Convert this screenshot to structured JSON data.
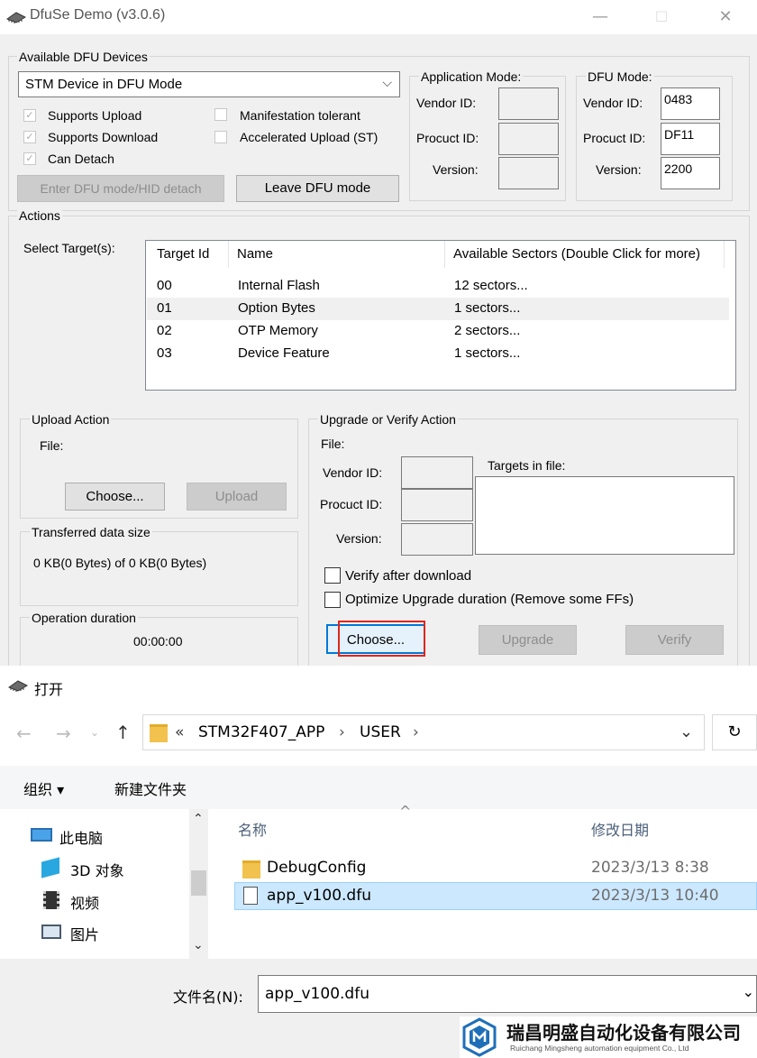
{
  "main_window": {
    "title": "DfuSe Demo (v3.0.6)",
    "controls": {
      "minimize": "—",
      "maximize": "☐",
      "close": "✕"
    },
    "devices": {
      "label": "Available DFU Devices",
      "selected": "STM Device in DFU Mode",
      "checks": [
        {
          "label": "Supports Upload",
          "checked": true
        },
        {
          "label": "Supports Download",
          "checked": true
        },
        {
          "label": "Can Detach",
          "checked": true
        },
        {
          "label": "Manifestation tolerant",
          "checked": false
        },
        {
          "label": "Accelerated Upload (ST)",
          "checked": false
        }
      ],
      "enter_dfu_button": "Enter DFU mode/HID detach",
      "leave_dfu_button": "Leave DFU mode"
    },
    "app_mode": {
      "label": "Application Mode:",
      "vendor_label": "Vendor ID:",
      "product_label": "Procuct ID:",
      "version_label": "Version:",
      "vendor": "",
      "product": "",
      "version": ""
    },
    "dfu_mode": {
      "label": "DFU Mode:",
      "vendor_label": "Vendor ID:",
      "product_label": "Procuct ID:",
      "version_label": "Version:",
      "vendor": "0483",
      "product": "DF11",
      "version": "2200"
    },
    "actions": {
      "label": "Actions",
      "select_target_label": "Select Target(s):",
      "columns": [
        "Target Id",
        "Name",
        "Available Sectors (Double Click for more)"
      ],
      "rows": [
        {
          "id": "00",
          "name": "Internal Flash",
          "sectors": "12 sectors..."
        },
        {
          "id": "01",
          "name": "Option Bytes",
          "sectors": "1 sectors..."
        },
        {
          "id": "02",
          "name": "OTP Memory",
          "sectors": "2 sectors..."
        },
        {
          "id": "03",
          "name": "Device Feature",
          "sectors": "1 sectors..."
        }
      ]
    },
    "upload": {
      "label": "Upload Action",
      "file_label": "File:",
      "choose_button": "Choose...",
      "upload_button": "Upload"
    },
    "transferred": {
      "label": "Transferred data size",
      "value": "0 KB(0 Bytes) of 0 KB(0 Bytes)"
    },
    "duration": {
      "label": "Operation duration",
      "value": "00:00:00"
    },
    "upgrade": {
      "label": "Upgrade or Verify Action",
      "file_label": "File:",
      "vendor_label": "Vendor ID:",
      "product_label": "Procuct ID:",
      "version_label": "Version:",
      "targets_label": "Targets in file:",
      "verify_after": "Verify after download",
      "optimize": "Optimize Upgrade duration (Remove some FFs)",
      "choose_button": "Choose...",
      "upgrade_button": "Upgrade",
      "verify_button": "Verify"
    }
  },
  "open_dialog": {
    "title": "打开",
    "path": [
      "«",
      "STM32F407_APP",
      "›",
      "USER",
      "›"
    ],
    "organize": "组织 ▾",
    "new_folder": "新建文件夹",
    "nav_items": [
      {
        "label": "此电脑",
        "icon": "computer-icon"
      },
      {
        "label": "3D 对象",
        "icon": "cube-icon"
      },
      {
        "label": "视频",
        "icon": "video-icon"
      },
      {
        "label": "图片",
        "icon": "picture-icon"
      }
    ],
    "columns": {
      "name": "名称",
      "date": "修改日期"
    },
    "files": [
      {
        "name": "DebugConfig",
        "date": "2023/3/13 8:38",
        "type": "folder"
      },
      {
        "name": "app_v100.dfu",
        "date": "2023/3/13 10:40",
        "type": "file"
      }
    ],
    "filename_label": "文件名(N):",
    "filename_value": "app_v100.dfu"
  },
  "watermark": {
    "company_cn": "瑞昌明盛自动化设备有限公司",
    "company_en": "Ruichang Mingsheng automation equipment Co., Ltd"
  }
}
